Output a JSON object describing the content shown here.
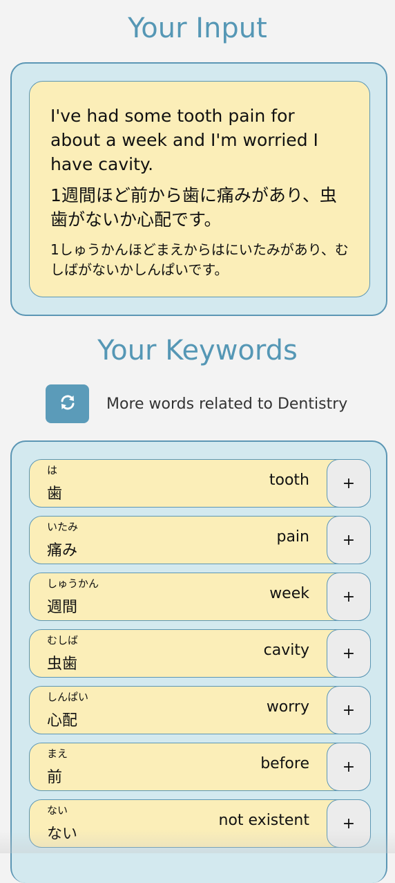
{
  "input_section": {
    "title": "Your Input",
    "english": "I've had some tooth pain for about a week and I'm worried I have cavity.",
    "japanese": "1週間ほど前から歯に痛みがあり、虫歯がないか心配です。",
    "kana": "1しゅうかんほどまえからはにいたみがあり、むしばがないかしんぱいです。"
  },
  "keywords_section": {
    "title": "Your Keywords",
    "refresh_icon": "refresh-icon",
    "refresh_label": "More words related to Dentistry",
    "add_label": "+",
    "items": [
      {
        "reading": "は",
        "word": "歯",
        "meaning": "tooth"
      },
      {
        "reading": "いたみ",
        "word": "痛み",
        "meaning": "pain"
      },
      {
        "reading": "しゅうかん",
        "word": "週間",
        "meaning": "week"
      },
      {
        "reading": "むしば",
        "word": "虫歯",
        "meaning": "cavity"
      },
      {
        "reading": "しんぱい",
        "word": "心配",
        "meaning": "worry"
      },
      {
        "reading": "まえ",
        "word": "前",
        "meaning": "before"
      },
      {
        "reading": "ない",
        "word": "ない",
        "meaning": "not existent"
      }
    ]
  },
  "colors": {
    "accent": "#5597b5",
    "panel_bg": "#d3e9ef",
    "card_bg": "#fbeeb8",
    "button_bg": "#5b9bb9"
  }
}
